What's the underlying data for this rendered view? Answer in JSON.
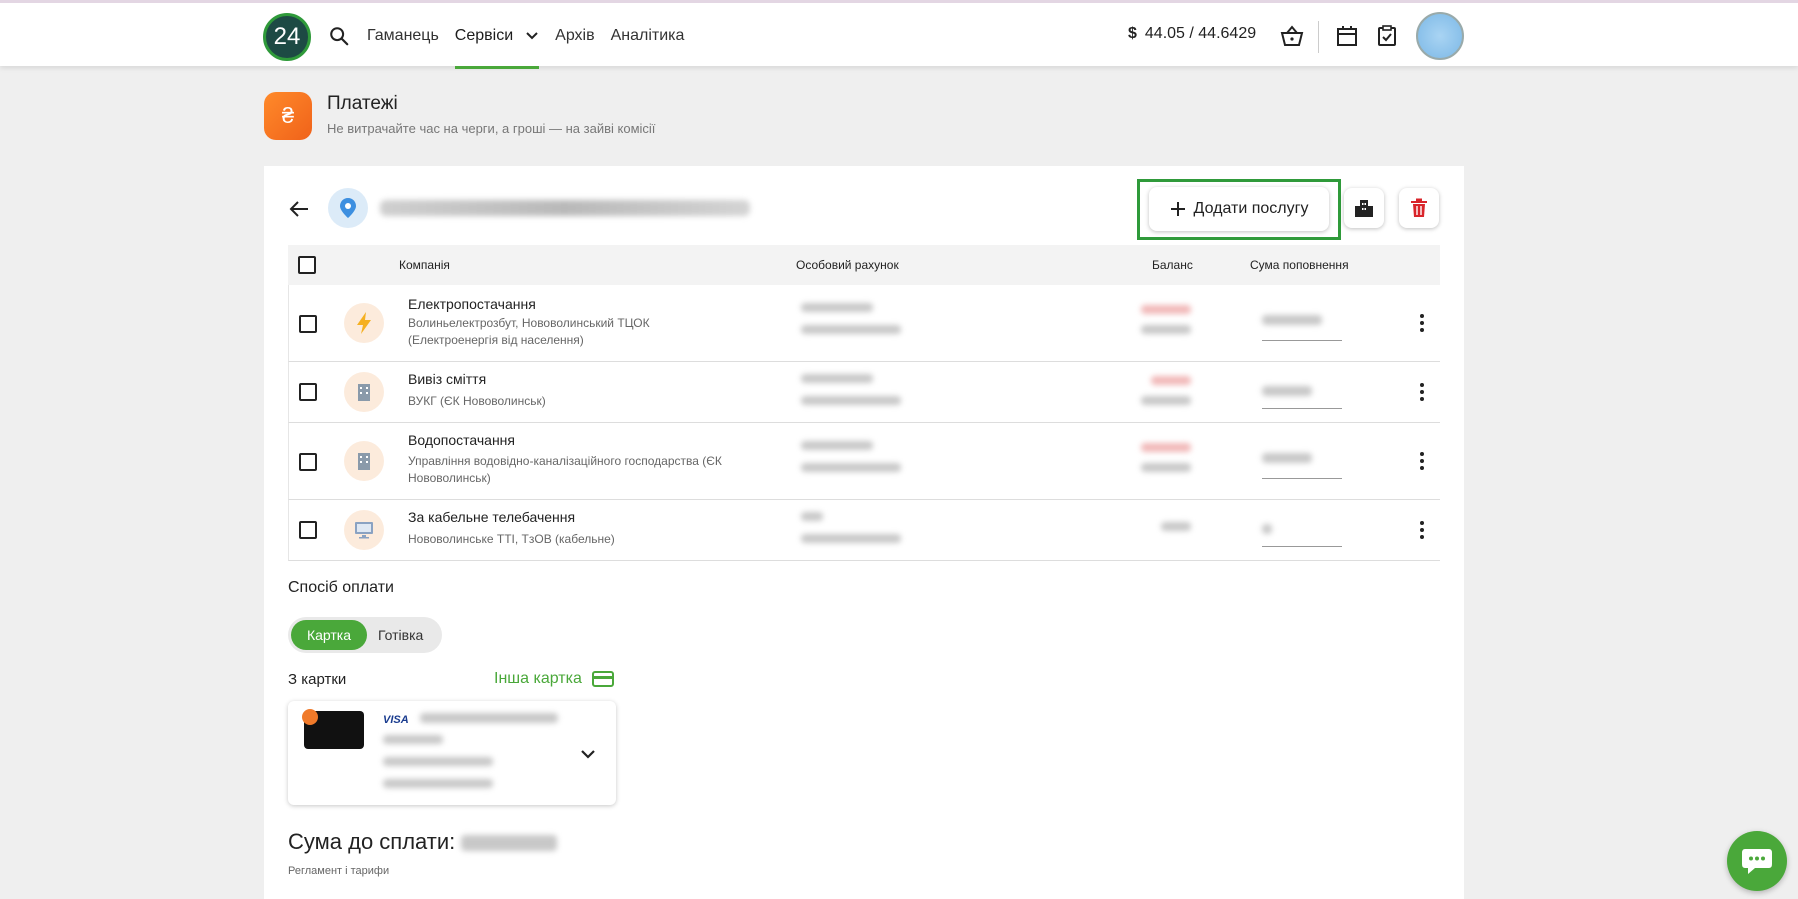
{
  "topbar": {
    "logo_text": "24",
    "nav": [
      {
        "label": "Гаманець"
      },
      {
        "label": "Сервіси"
      },
      {
        "label": "Архів"
      },
      {
        "label": "Аналітика"
      }
    ],
    "currency_symbol": "$",
    "rate": "44.05 / 44.6429",
    "active_color": "#4aa83a"
  },
  "page": {
    "icon_glyph": "₴",
    "title": "Платежі",
    "subtitle": "Не витрачайте час на черги, а гроші — на зайві комісії"
  },
  "toolbar": {
    "add_service_label": "Додати послугу"
  },
  "table": {
    "headers": {
      "company": "Компанія",
      "account": "Особовий рахунок",
      "balance": "Баланс",
      "amount": "Сума поповнення"
    },
    "rows": [
      {
        "name": "Електропостачання",
        "desc": "Волиньелектрозбут, Нововолинський ТЦОК (Електроенергія від населення)",
        "icon": "lightning-icon"
      },
      {
        "name": "Вивіз сміття",
        "desc": "ВУКГ (ЄК Нововолинськ)",
        "icon": "building-icon"
      },
      {
        "name": "Водопостачання",
        "desc": "Управління водовідно-каналізаційного господарства (ЄК Нововолинськ)",
        "icon": "building-icon"
      },
      {
        "name": "За кабельне телебачення",
        "desc": "Нововолинське ТТІ, ТзОВ (кабельне)",
        "icon": "monitor-icon"
      }
    ]
  },
  "payment": {
    "method_label": "Спосіб оплати",
    "card_option": "Картка",
    "cash_option": "Готівка",
    "from_card_label": "З картки",
    "other_card_label": "Інша картка",
    "card_brand": "VISA"
  },
  "total": {
    "label": "Сума до сплати:",
    "reglament": "Регламент і тарифи"
  }
}
